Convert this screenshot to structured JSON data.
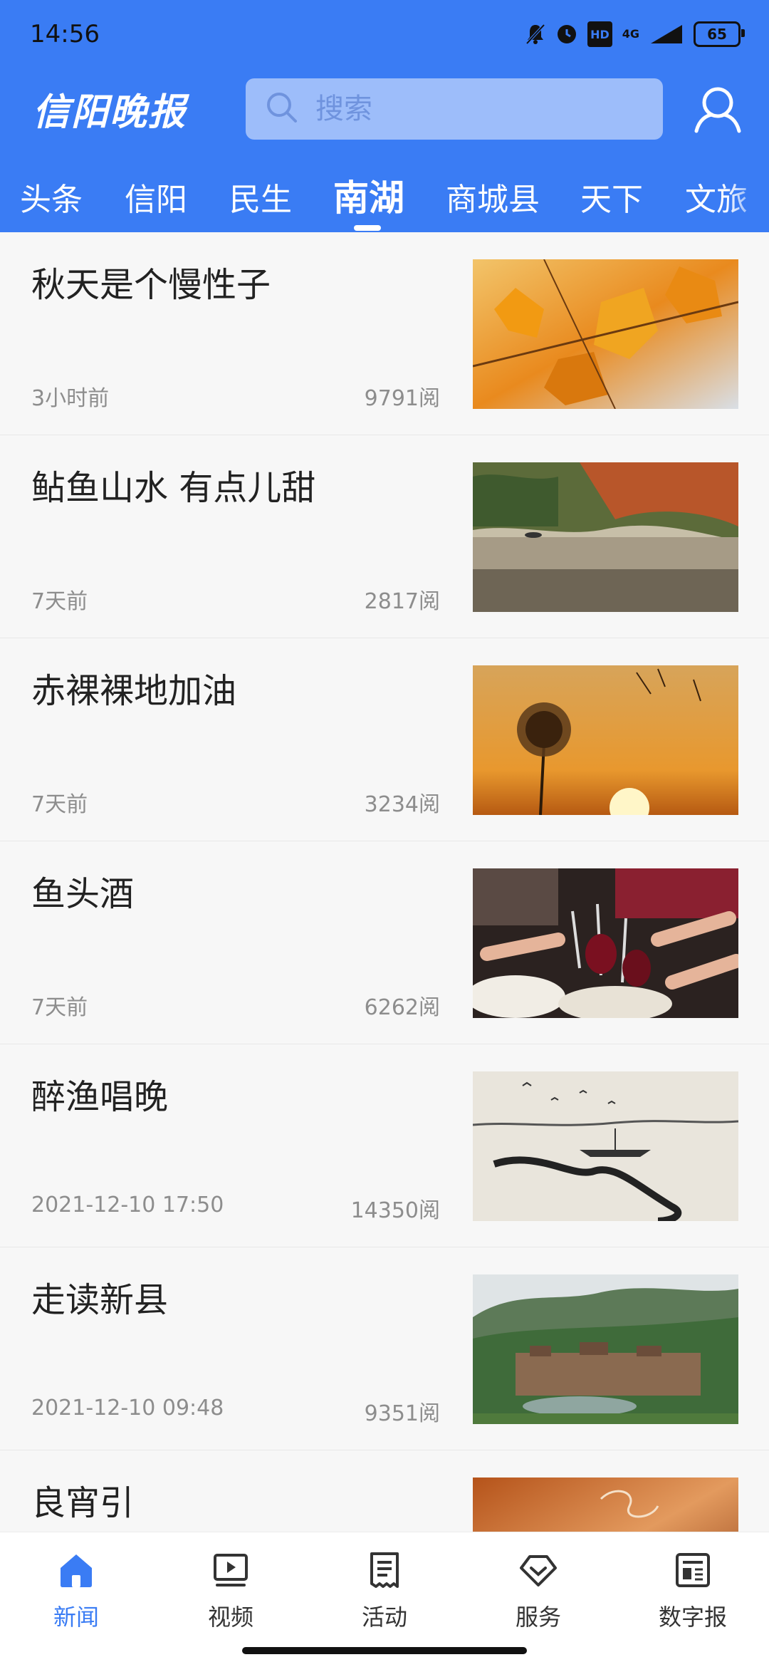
{
  "status_bar": {
    "time": "14:56",
    "hd": "HD",
    "network": "4G",
    "battery": "65"
  },
  "header": {
    "logo_text": "信阳晚报",
    "search_placeholder": "搜索",
    "brand_color": "#3a7cf4"
  },
  "tabs": [
    {
      "label": "头条",
      "active": false
    },
    {
      "label": "信阳",
      "active": false
    },
    {
      "label": "民生",
      "active": false
    },
    {
      "label": "南湖",
      "active": true
    },
    {
      "label": "商城县",
      "active": false
    },
    {
      "label": "天下",
      "active": false
    },
    {
      "label": "文旅",
      "active": false
    }
  ],
  "news": [
    {
      "title": "秋天是个慢性子",
      "time": "3小时前",
      "reads": "9791阅",
      "image": "autumn-maple-leaves"
    },
    {
      "title": "鲇鱼山水 有点儿甜",
      "time": "7天前",
      "reads": "2817阅",
      "image": "lake-autumn-forest"
    },
    {
      "title": "赤裸裸地加油",
      "time": "7天前",
      "reads": "3234阅",
      "image": "dandelion-sunset"
    },
    {
      "title": "鱼头酒",
      "time": "7天前",
      "reads": "6262阅",
      "image": "wine-toast"
    },
    {
      "title": "醉渔唱晚",
      "time": "2021-12-10 17:50",
      "reads": "14350阅",
      "image": "ink-painting-fisherman"
    },
    {
      "title": "走读新县",
      "time": "2021-12-10 09:48",
      "reads": "9351阅",
      "image": "mountain-village"
    },
    {
      "title": "良宵引",
      "time": "",
      "reads": "",
      "image": "incense-smoke"
    }
  ],
  "bottom_nav": [
    {
      "label": "新闻",
      "icon": "home-icon",
      "active": true
    },
    {
      "label": "视频",
      "icon": "video-icon",
      "active": false
    },
    {
      "label": "活动",
      "icon": "activity-icon",
      "active": false
    },
    {
      "label": "服务",
      "icon": "service-icon",
      "active": false
    },
    {
      "label": "数字报",
      "icon": "newspaper-icon",
      "active": false
    }
  ]
}
